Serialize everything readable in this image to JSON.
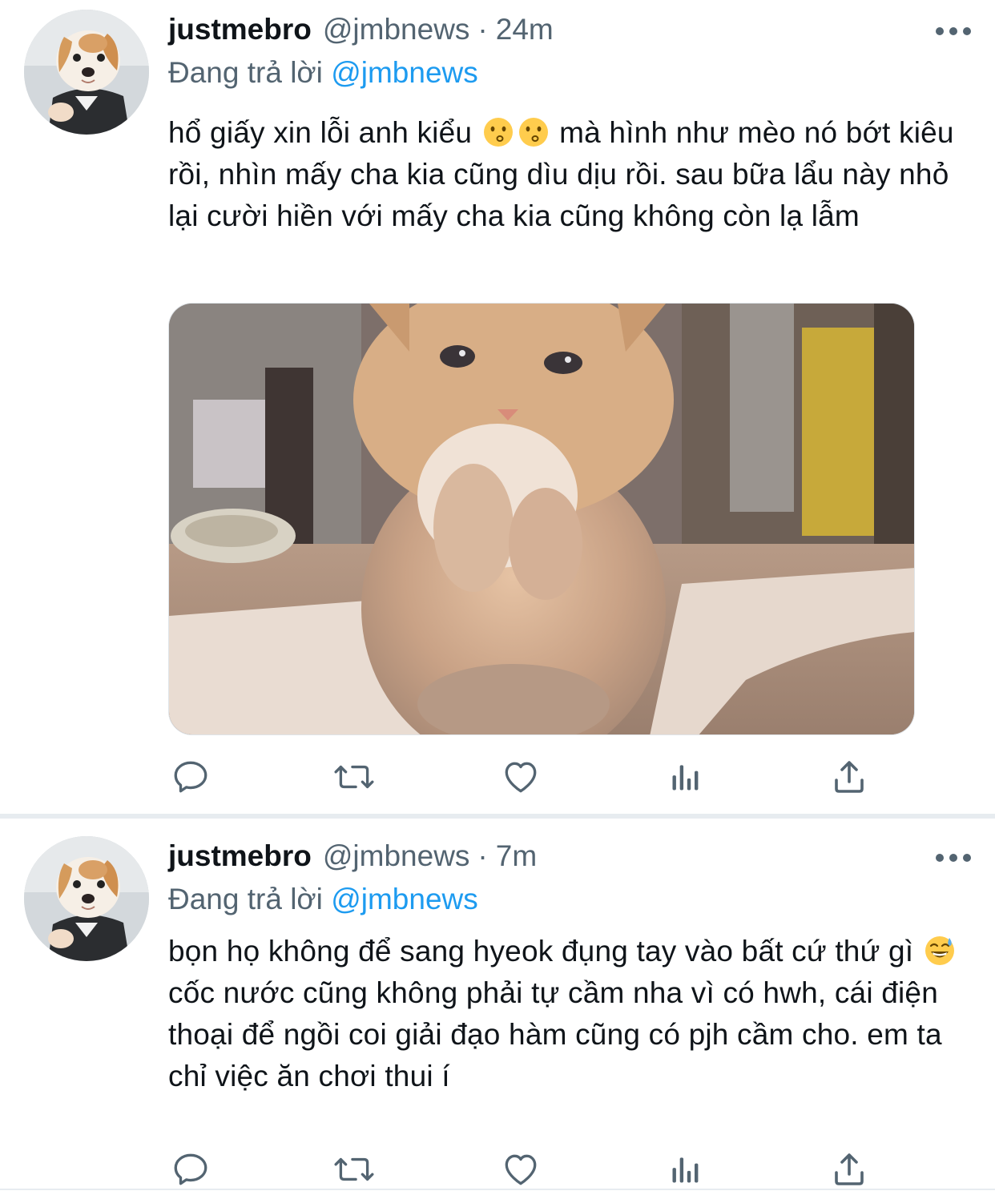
{
  "tweets": [
    {
      "display_name": "justmebro",
      "handle": "@jmbnews",
      "separator": "·",
      "time": "24m",
      "reply_prefix": "Đang trả lời",
      "reply_handle": "@jmbnews",
      "text_1": "hổ giấy xin lỗi anh kiểu",
      "emoji_1": "kissing-face",
      "emoji_2": "kissing-face",
      "text_2": "mà hình như mèo nó bớt kiêu rồi, nhìn mấy cha kia cũng dìu dịu rồi. sau bữa lẩu này nhỏ lại cười hiền với mấy cha kia cũng không còn lạ lẫm",
      "media": "kitten-photo"
    },
    {
      "display_name": "justmebro",
      "handle": "@jmbnews",
      "separator": "·",
      "time": "7m",
      "reply_prefix": "Đang trả lời",
      "reply_handle": "@jmbnews",
      "text_1": "bọn họ không để sang hyeok đụng tay vào bất cứ thứ gì",
      "emoji_1": "grinning-sweat-face",
      "text_2": "cốc nước cũng không phải tự cầm nha vì có hwh, cái điện thoại để ngồi coi giải đạo hàm cũng có pjh cầm cho. em ta chỉ việc ăn chơi thui í"
    }
  ],
  "icons": {
    "reply": "reply-icon",
    "retweet": "retweet-icon",
    "like": "heart-icon",
    "views": "views-icon",
    "share": "share-icon",
    "more": "more-icon"
  },
  "colors": {
    "text": "#0f1419",
    "secondary": "#536471",
    "link": "#1d9bf0",
    "divider": "#e7ecf0"
  }
}
